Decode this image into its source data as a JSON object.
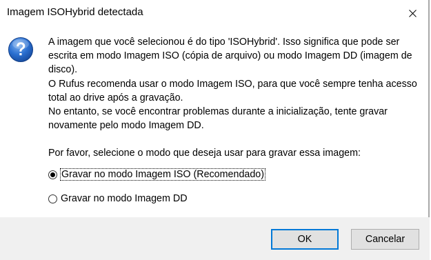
{
  "dialog": {
    "title": "Imagem ISOHybrid detectada",
    "icon": "question-icon",
    "message": [
      "A imagem que você selecionou é do tipo 'ISOHybrid'. Isso significa que pode ser escrita em modo Imagem ISO (cópia de arquivo) ou modo Imagem DD (imagem de disco).",
      "O Rufus recomenda usar o modo Imagem ISO, para que você sempre tenha acesso total ao drive após a gravação.",
      "No entanto, se você encontrar problemas durante a inicialização, tente gravar novamente pelo modo Imagem DD."
    ],
    "prompt": "Por favor, selecione o modo que deseja usar para gravar essa imagem:",
    "options": [
      {
        "label": "Gravar no modo Imagem ISO (Recomendado)",
        "checked": true
      },
      {
        "label": "Gravar no modo Imagem DD",
        "checked": false
      }
    ],
    "buttons": {
      "ok": "OK",
      "cancel": "Cancelar"
    },
    "colors": {
      "accent": "#0078d7",
      "icon_blue": "#1e5bb8",
      "footer_bg": "#f0f0f0"
    }
  }
}
